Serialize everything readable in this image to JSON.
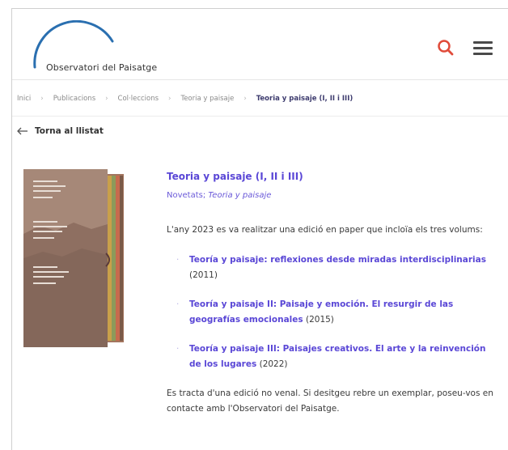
{
  "header": {
    "logo_text": "Observatori del Paisatge",
    "search_icon": "search-icon",
    "menu_icon": "hamburger-menu-icon",
    "accent_color": "#e04b3a"
  },
  "breadcrumb": {
    "items": [
      "Inici",
      "Publicacions",
      "Col·leccions",
      "Teoria y paisaje"
    ],
    "current": "Teoria y paisaje (I, II i III)"
  },
  "back_link": "Torna al llistat",
  "book": {
    "title": "Teoria y paisaje (I, II i III)",
    "category": "Novetats",
    "separator": ";",
    "collection": "Teoria y paisaje",
    "intro": "L'any 2023 es va realitzar una edició en paper que incloïa els tres volums:",
    "volumes": [
      {
        "title": "Teoría y paisaje: reflexiones desde miradas interdisciplinarias",
        "year": "(2011)"
      },
      {
        "title": "Teoría y paisaje II: Paisaje y emoción. El resurgir de las geografías emocionales",
        "year": "(2015)"
      },
      {
        "title": "Teoría y paisaje III: Paisajes creativos. El arte y la reinvención de los lugares",
        "year": "(2022)"
      }
    ],
    "outro": "Es tracta d'una edició no venal. Si desitgeu rebre un exemplar, poseu-vos en contacte amb l'Observatori del Paisatge."
  },
  "colors": {
    "link": "#5a47d6",
    "text": "#3a3a3a",
    "muted": "#8a8a8a"
  }
}
